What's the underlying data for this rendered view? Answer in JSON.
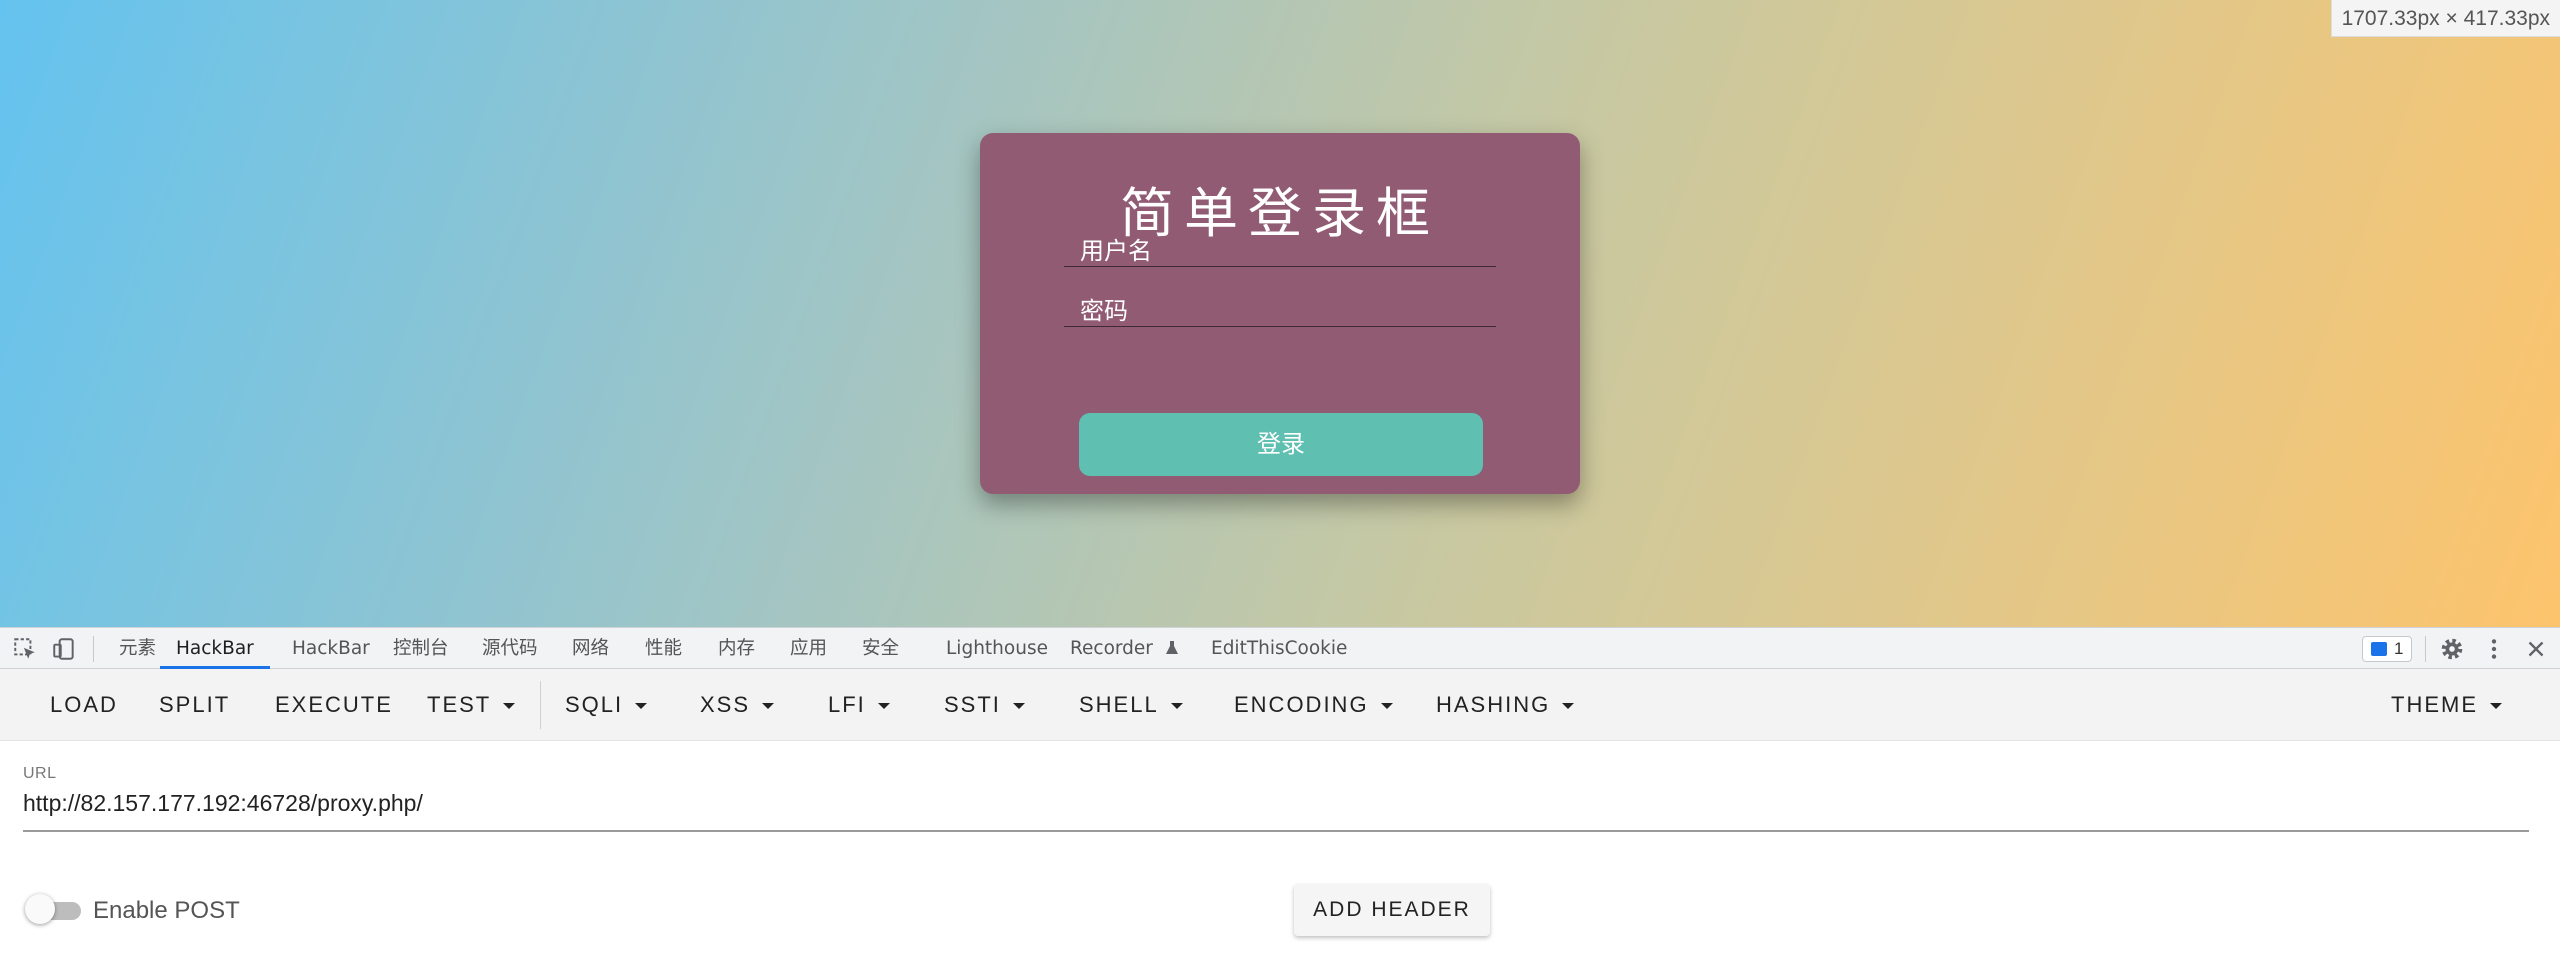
{
  "page": {
    "dimension_badge": "1707.33px × 417.33px",
    "login": {
      "title": "简单登录框",
      "username_placeholder": "用户名",
      "password_placeholder": "密码",
      "submit_label": "登录",
      "colors": {
        "card": "#925b74",
        "button": "#5fbfb1"
      }
    }
  },
  "devtools": {
    "tabs": [
      {
        "label": "元素",
        "active": false
      },
      {
        "label": "HackBar",
        "active": true
      },
      {
        "label": "HackBar",
        "active": false
      },
      {
        "label": "控制台",
        "active": false
      },
      {
        "label": "源代码",
        "active": false
      },
      {
        "label": "网络",
        "active": false
      },
      {
        "label": "性能",
        "active": false
      },
      {
        "label": "内存",
        "active": false
      },
      {
        "label": "应用",
        "active": false
      },
      {
        "label": "安全",
        "active": false
      },
      {
        "label": "Lighthouse",
        "active": false
      },
      {
        "label": "Recorder",
        "active": false
      },
      {
        "label": "EditThisCookie",
        "active": false
      }
    ],
    "issues_count": "1",
    "accent": "#1a73e8"
  },
  "hackbar": {
    "buttons": [
      "LOAD",
      "SPLIT",
      "EXECUTE",
      "TEST",
      "SQLI",
      "XSS",
      "LFI",
      "SSTI",
      "SHELL",
      "ENCODING",
      "HASHING",
      "THEME"
    ],
    "url_label": "URL",
    "url_value": "http://82.157.177.192:46728/proxy.php/",
    "enable_post_label": "Enable POST",
    "enable_post": false,
    "add_header_label": "ADD HEADER"
  }
}
